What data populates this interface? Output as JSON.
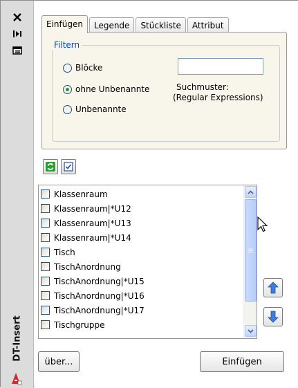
{
  "palette": {
    "title": "DT-Insert",
    "buttons": [
      {
        "icon": "close-icon"
      },
      {
        "icon": "autohide-icon"
      },
      {
        "icon": "properties-icon"
      }
    ],
    "app_icon": "autocad-icon"
  },
  "tabs": [
    {
      "label": "Einfügen",
      "active": true
    },
    {
      "label": "Legende",
      "active": false
    },
    {
      "label": "Stückliste",
      "active": false
    },
    {
      "label": "Attribut",
      "active": false
    }
  ],
  "filter": {
    "legend": "Filtern",
    "options": [
      {
        "label": "Blöcke",
        "checked": false
      },
      {
        "label": "ohne Unbenannte",
        "checked": true
      },
      {
        "label": "Unbenannte",
        "checked": false
      }
    ],
    "pattern_value": "",
    "pattern_hint_line1": "Suchmuster:",
    "pattern_hint_line2": "(Regular Expressions)"
  },
  "toolbar": [
    {
      "icon": "refresh-icon"
    },
    {
      "icon": "check-all-icon"
    }
  ],
  "block_list": [
    {
      "name": "Klassenraum",
      "checked": false
    },
    {
      "name": "Klassenraum|*U12",
      "checked": false
    },
    {
      "name": "Klassenraum|*U13",
      "checked": false
    },
    {
      "name": "Klassenraum|*U14",
      "checked": false
    },
    {
      "name": "Tisch",
      "checked": false
    },
    {
      "name": "TischAnordnung",
      "checked": false
    },
    {
      "name": "TischAnordnung|*U15",
      "checked": false
    },
    {
      "name": "TischAnordnung|*U16",
      "checked": false
    },
    {
      "name": "TischAnordnung|*U17",
      "checked": false
    },
    {
      "name": "Tischgruppe",
      "checked": false
    }
  ],
  "reorder": [
    {
      "icon": "move-up-icon"
    },
    {
      "icon": "move-down-icon"
    }
  ],
  "buttons": {
    "about": "über...",
    "insert": "Einfügen"
  },
  "colors": {
    "accent_blue": "#0046d5",
    "panel_bg": "#f8f6ea",
    "radio_dot": "#21a121"
  }
}
